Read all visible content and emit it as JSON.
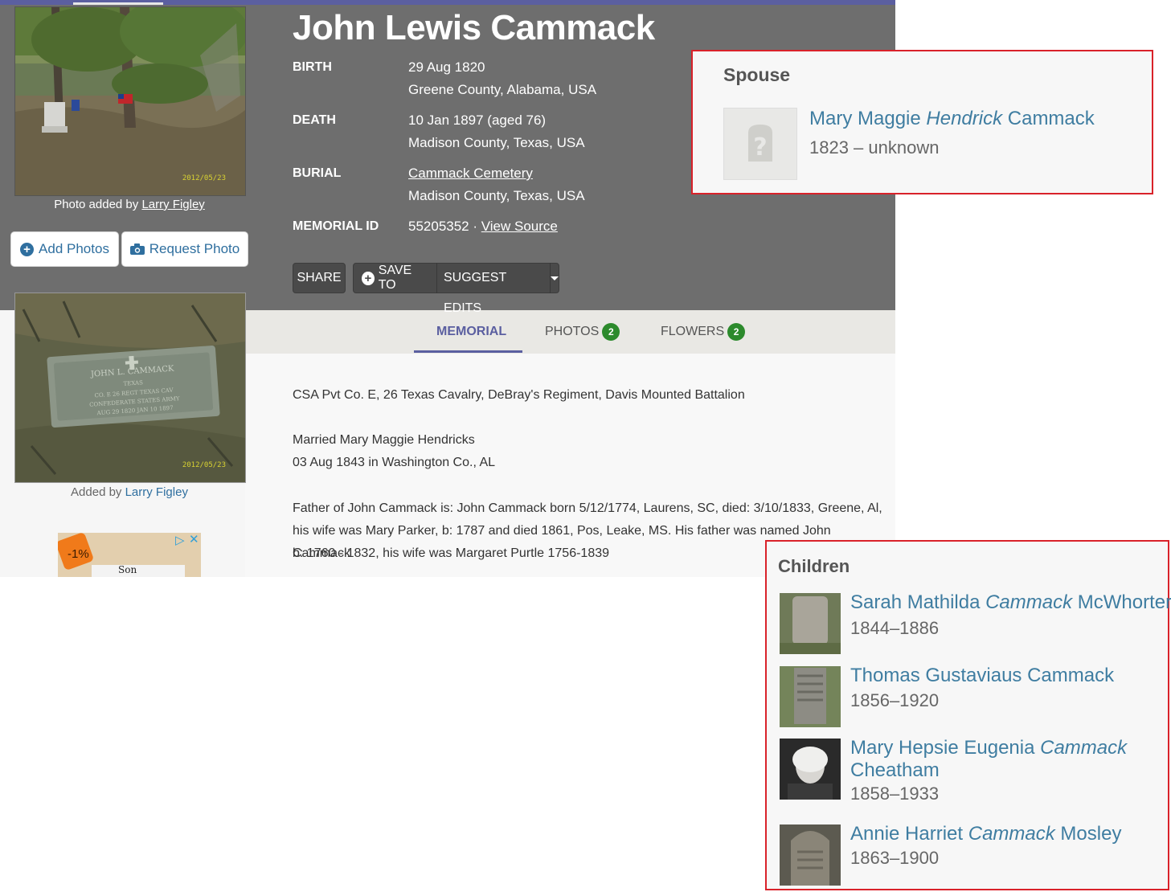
{
  "memorial": {
    "name": "John Lewis Cammack",
    "birth": {
      "label": "BIRTH",
      "date": "29 Aug 1820",
      "place": "Greene County, Alabama, USA"
    },
    "death": {
      "label": "DEATH",
      "date": "10 Jan 1897 (aged 76)",
      "place": "Madison County, Texas, USA"
    },
    "burial": {
      "label": "BURIAL",
      "cemetery": "Cammack Cemetery",
      "place": "Madison County, Texas, USA"
    },
    "memorial_id": {
      "label": "MEMORIAL ID",
      "value": "55205352 · ",
      "source_link": "View Source"
    }
  },
  "photo": {
    "caption_prefix": "Photo added by ",
    "caption_user": "Larry Figley",
    "stamp": "2012/05/23",
    "add_photos": "Add Photos",
    "request_photo": "Request Photo",
    "second_caption_prefix": "Added by ",
    "second_caption_user": "Larry Figley",
    "headstone_text": [
      "JOHN L. CAMMACK",
      "TEXAS",
      "CO. E 26 REGT TEXAS CAV",
      "CONFEDERATE STATES ARMY",
      "AUG 29 1820    JAN 10 1897"
    ]
  },
  "actions": {
    "share": "SHARE",
    "save_to": "SAVE TO",
    "suggest_edits": "SUGGEST EDITS"
  },
  "tabs": {
    "memorial": "MEMORIAL",
    "photos": "PHOTOS",
    "photos_count": "2",
    "flowers": "FLOWERS",
    "flowers_count": "2"
  },
  "bio": {
    "line1": "CSA Pvt Co. E, 26 Texas Cavalry, DeBray's Regiment, Davis Mounted Battalion",
    "line2": "Married Mary Maggie Hendricks",
    "line3": "03 Aug 1843 in Washington Co., AL",
    "line4": "Father of John Cammack is: John Cammack born 5/12/1774, Laurens, SC, died: 3/10/1833, Greene, Al,",
    "line5": "his wife was Mary Parker, b: 1787 and died 1861, Pos, Leake, MS. His father was named John Cammack",
    "line6": "b: 1760 - 1832, his wife was Margaret Purtle 1756-1839"
  },
  "ad": {
    "discount": "-1%",
    "text": "Son"
  },
  "spouse": {
    "title": "Spouse",
    "first": "Mary Maggie ",
    "maiden": "Hendrick",
    "last": " Cammack",
    "dates": "1823 – unknown"
  },
  "children": {
    "title": "Children",
    "items": [
      {
        "first": "Sarah Mathilda ",
        "maiden": "Cammack",
        "last": " McWhorter",
        "dates": "1844–1886"
      },
      {
        "first": "Thomas Gustaviaus Cammack",
        "maiden": "",
        "last": "",
        "dates": "1856–1920"
      },
      {
        "first": "Mary Hepsie Eugenia ",
        "maiden": "Cammack",
        "last": "",
        "line2": "Cheatham",
        "dates": "1858–1933"
      },
      {
        "first": "Annie Harriet ",
        "maiden": "Cammack",
        "last": " Mosley",
        "dates": "1863–1900"
      }
    ]
  },
  "colors": {
    "header_bg": "#6e6e6e",
    "accent_purple": "#5b5fa0",
    "link_blue": "#3f7da1",
    "badge_green": "#2c8a2c",
    "highlight_red": "#d9222a"
  }
}
